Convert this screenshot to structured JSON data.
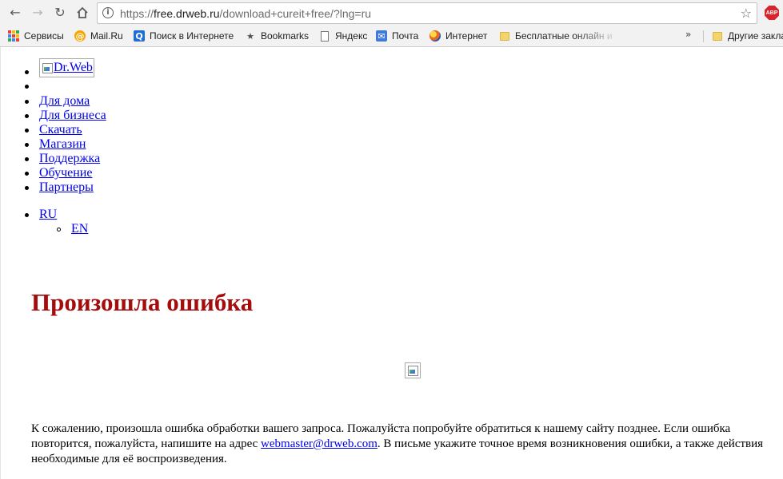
{
  "browser": {
    "url_host": "free.drweb.ru",
    "url_scheme": "https://",
    "url_path": "/download+cureit+free/?lng=ru",
    "extension_label": "ABP",
    "bookmarks": [
      {
        "label": "Сервисы",
        "icon": "apps-grid-icon"
      },
      {
        "label": "Mail.Ru",
        "icon": "mailru-icon"
      },
      {
        "label": "Поиск в Интернете",
        "icon": "search-icon"
      },
      {
        "label": "Bookmarks",
        "icon": "star-icon"
      },
      {
        "label": "Яндекс",
        "icon": "page-icon"
      },
      {
        "label": "Почта",
        "icon": "mail-icon"
      },
      {
        "label": "Интернет",
        "icon": "globe-icon"
      },
      {
        "label": "Бесплатные онлайн и",
        "icon": "folder-icon"
      }
    ],
    "overflow_label": "»",
    "other_bookmarks": "Другие закла"
  },
  "page": {
    "logo_alt": "Dr.Web",
    "nav": [
      "Для дома",
      "Для бизнеса",
      "Скачать",
      "Магазин",
      "Поддержка",
      "Обучение",
      "Партнеры"
    ],
    "lang_current": "RU",
    "lang_other": "EN",
    "error_title": "Произошла ошибка",
    "message_part1": "К сожалению, произошла ошибка обработки вашего запроса. Пожалуйста попробуйте обратиться к нашему сайту позднее. Если ошибка повторится, пожалуйста, напишите на адрес ",
    "message_email": "webmaster@drweb.com",
    "message_part2": ". В письме укажите точное время возникновения ошибки, а также действия необходимые для её воспроизведения."
  },
  "colors": {
    "title": "#a50d0d",
    "link": "#0000ee",
    "abp": "#d9242b"
  }
}
